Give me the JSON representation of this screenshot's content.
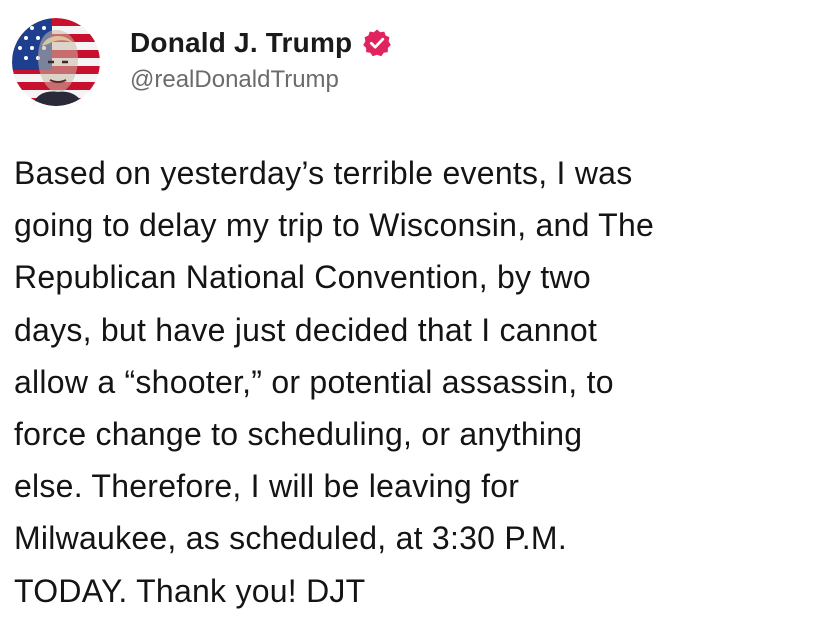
{
  "author": {
    "display_name": "Donald J. Trump",
    "handle": "@realDonaldTrump",
    "verified": true,
    "avatar_icon": "flag-portrait-avatar",
    "verified_icon": "verified-badge-icon",
    "verified_color": "#E0245E"
  },
  "post": {
    "text": "Based on yesterday’s terrible events, I was\ngoing to delay my trip to Wisconsin, and The\nRepublican National Convention, by two\ndays, but have just decided that I cannot\nallow a “shooter,” or potential assassin, to\nforce change to scheduling, or anything\nelse. Therefore, I will be leaving for\nMilwaukee, as scheduled, at 3:30 P.M.\nTODAY. Thank you! DJT"
  }
}
